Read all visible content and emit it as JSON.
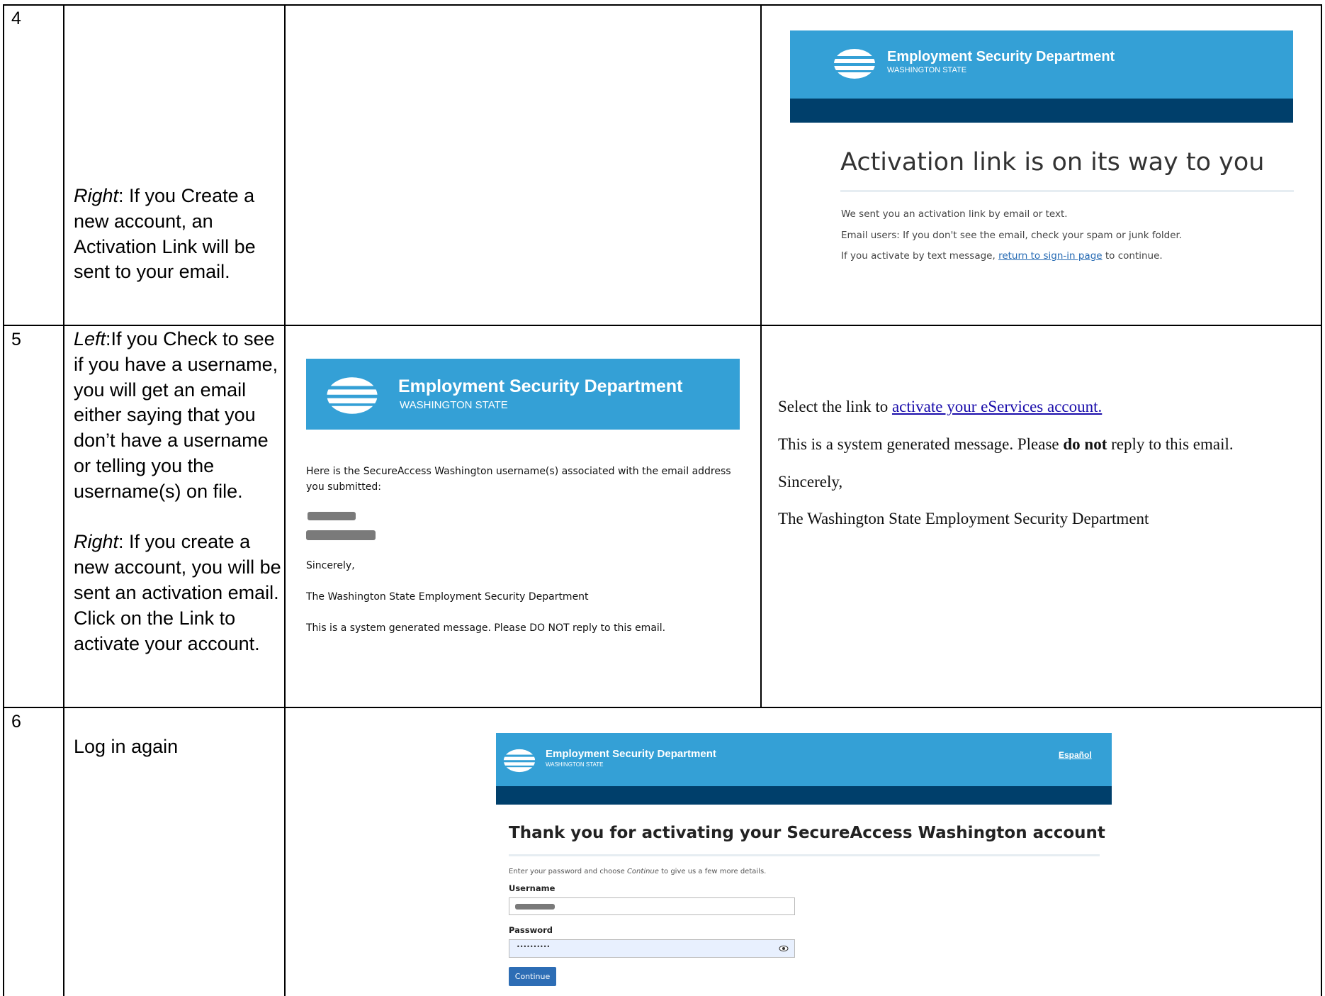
{
  "rows": [
    {
      "step": "4",
      "description": {
        "right_label": "Right",
        "right_text": ": If you Create a new account, an Activation Link will be sent to your email."
      },
      "screenshot": {
        "banner_title": "Employment Security Department",
        "banner_sub": "WASHINGTON STATE",
        "heading": "Activation link is on its way to you",
        "line1": "We sent you an activation link by email or text.",
        "line2": "Email users: If you don't see the email, check your spam or junk folder.",
        "line3_pre": "If you activate by text message, ",
        "line3_link": "return to sign-in page",
        "line3_post": " to continue."
      }
    },
    {
      "step": "5",
      "description": {
        "left_label": "Left",
        "left_text": ":If you Check to see if you have a username, you will get an email either saying that you don’t have a username or telling you the username(s) on file.",
        "right_label": "Right",
        "right_text": ": If you create a new account, you will be sent an activation email. Click on the Link to activate your account."
      },
      "left_email": {
        "banner_title": "Employment Security Department",
        "banner_sub": "WASHINGTON STATE",
        "intro": "Here is the SecureAccess Washington username(s) associated with the email address you submitted:",
        "sincerely": "Sincerely,",
        "signature": "The Washington State Employment Security Department",
        "footer": "This is a system generated message. Please DO NOT reply to this email."
      },
      "right_email": {
        "select_pre": "Select the link to ",
        "select_link": "activate your eServices account.",
        "system_pre": "This is a system generated message. Please ",
        "system_bold": "do not",
        "system_post": " reply to this email.",
        "sincerely": "Sincerely,",
        "signature": "The Washington State Employment Security Department"
      }
    },
    {
      "step": "6",
      "description": {
        "text": "Log in again"
      },
      "screenshot": {
        "banner_title": "Employment Security Department",
        "banner_sub": "WASHINGTON STATE",
        "language_link": "Español",
        "heading": "Thank you for activating your SecureAccess Washington account",
        "instr_pre": "Enter your password and choose ",
        "instr_em": "Continue",
        "instr_post": " to give us a few more details.",
        "username_label": "Username",
        "password_label": "Password",
        "password_value": "••••••••••",
        "continue_label": "Continue"
      }
    }
  ],
  "colors": {
    "banner_blue": "#34a0d6",
    "banner_dark": "#003f6b",
    "link_blue": "#1a0dab",
    "button_blue": "#2d6db5"
  },
  "icons": [
    "esd-logo-icon",
    "eye-icon"
  ]
}
